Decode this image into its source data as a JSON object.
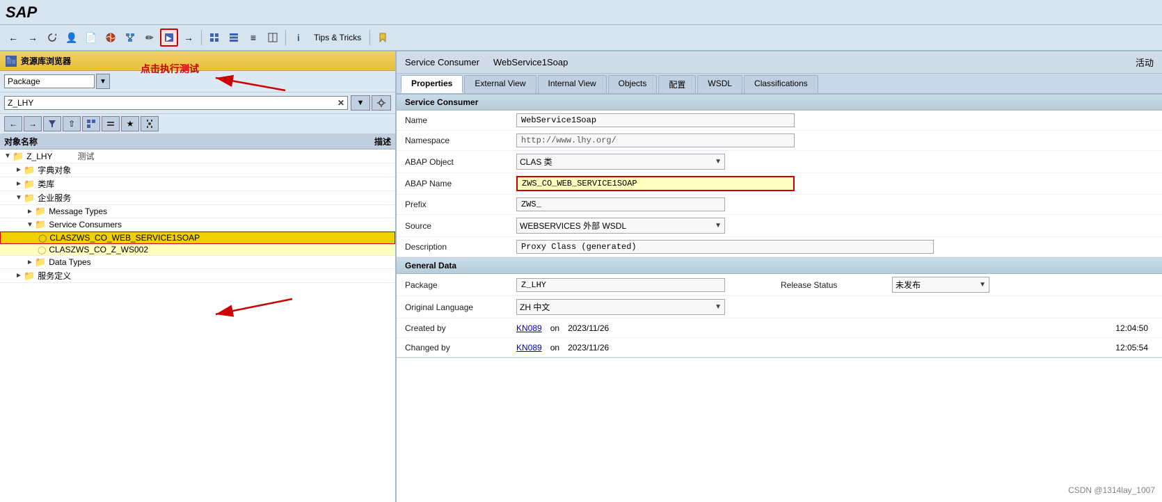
{
  "app": {
    "logo": "SAP",
    "title": "资源库浏览器"
  },
  "toolbar": {
    "buttons": [
      {
        "name": "back-btn",
        "icon": "←"
      },
      {
        "name": "forward-btn",
        "icon": "→"
      },
      {
        "name": "refresh-btn",
        "icon": "⟳"
      },
      {
        "name": "user-btn",
        "icon": "👤"
      },
      {
        "name": "page-btn",
        "icon": "📄"
      },
      {
        "name": "globe-btn",
        "icon": "🌐"
      },
      {
        "name": "network-btn",
        "icon": "⊞"
      },
      {
        "name": "pencil-btn",
        "icon": "✏"
      },
      {
        "name": "execute-btn",
        "icon": "▶",
        "highlight": true
      },
      {
        "name": "arrow-btn",
        "icon": "→"
      },
      {
        "name": "grid1-btn",
        "icon": "▦"
      },
      {
        "name": "grid2-btn",
        "icon": "⊞"
      },
      {
        "name": "grid3-btn",
        "icon": "≡"
      },
      {
        "name": "grid4-btn",
        "icon": "⊟"
      },
      {
        "name": "info-btn",
        "icon": "ℹ"
      },
      {
        "name": "tips-tricks-btn",
        "icon": "Tips & Tricks"
      },
      {
        "name": "bookmark-btn",
        "icon": "🔖"
      }
    ]
  },
  "left_panel": {
    "header": "资源库浏览器",
    "dropdown_value": "Package",
    "search_value": "Z_LHY",
    "col_name": "对象名称",
    "col_desc": "描述",
    "tree": [
      {
        "level": 0,
        "type": "folder",
        "expanded": true,
        "name": "Z_LHY",
        "desc": "测试"
      },
      {
        "level": 1,
        "type": "folder",
        "expanded": true,
        "name": "字典对象",
        "desc": ""
      },
      {
        "level": 1,
        "type": "folder",
        "expanded": true,
        "name": "类库",
        "desc": ""
      },
      {
        "level": 1,
        "type": "folder",
        "expanded": true,
        "name": "企业服务",
        "desc": ""
      },
      {
        "level": 2,
        "type": "folder",
        "expanded": true,
        "name": "Message Types",
        "desc": ""
      },
      {
        "level": 2,
        "type": "folder",
        "expanded": true,
        "name": "Service Consumers",
        "desc": ""
      },
      {
        "level": 3,
        "type": "item",
        "selected": true,
        "name": "CLASZWS_CO_WEB_SERVICE1SOAP",
        "desc": ""
      },
      {
        "level": 3,
        "type": "item",
        "selected": false,
        "name": "CLASZWS_CO_Z_WS002",
        "desc": ""
      },
      {
        "level": 2,
        "type": "folder",
        "expanded": false,
        "name": "Data Types",
        "desc": ""
      },
      {
        "level": 1,
        "type": "folder",
        "expanded": false,
        "name": "服务定义",
        "desc": ""
      }
    ]
  },
  "right_panel": {
    "sc_label": "Service Consumer",
    "sc_name": "WebService1Soap",
    "sc_status": "活动",
    "tabs": [
      {
        "id": "properties",
        "label": "Properties",
        "active": true
      },
      {
        "id": "external-view",
        "label": "External View"
      },
      {
        "id": "internal-view",
        "label": "Internal View"
      },
      {
        "id": "objects",
        "label": "Objects"
      },
      {
        "id": "config",
        "label": "配置"
      },
      {
        "id": "wsdl",
        "label": "WSDL"
      },
      {
        "id": "classifications",
        "label": "Classifications"
      }
    ],
    "sections": {
      "service_consumer": {
        "title": "Service Consumer",
        "fields": {
          "name_label": "Name",
          "name_value": "WebService1Soap",
          "namespace_label": "Namespace",
          "namespace_value": "http://www.lhy.org/",
          "abap_object_label": "ABAP Object",
          "abap_object_value": "CLAS 类",
          "abap_name_label": "ABAP Name",
          "abap_name_value": "ZWS_CO_WEB_SERVICE1SOAP",
          "prefix_label": "Prefix",
          "prefix_value": "ZWS_",
          "source_label": "Source",
          "source_value": "WEBSERVICES 外部 WSDL",
          "description_label": "Description",
          "description_value": "Proxy Class (generated)"
        }
      },
      "general_data": {
        "title": "General Data",
        "fields": {
          "package_label": "Package",
          "package_value": "Z_LHY",
          "release_status_label": "Release Status",
          "release_status_value": "未发布",
          "orig_lang_label": "Original Language",
          "orig_lang_value": "ZH 中文",
          "created_by_label": "Created by",
          "created_by_link": "KN089",
          "created_on_label": "on",
          "created_date": "2023/11/26",
          "created_time": "12:04:50",
          "changed_by_label": "Changed by",
          "changed_by_link": "KN089",
          "changed_on_label": "on",
          "changed_date": "2023/11/26",
          "changed_time": "12:05:54"
        }
      }
    }
  },
  "annotations": {
    "execute_annotation": "点击执行测试"
  },
  "watermark": "CSDN @1314lay_1007"
}
